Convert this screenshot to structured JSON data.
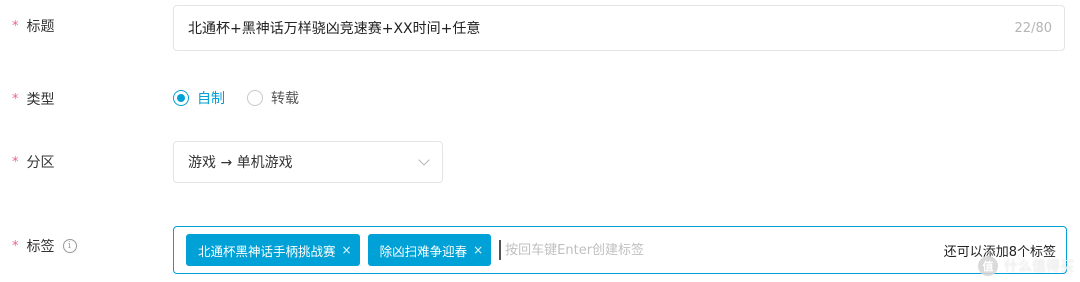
{
  "form": {
    "title": {
      "label": "标题",
      "value": "北通杯+黑神话万样骁凶竞速赛+XX时间+任意",
      "count": "22/80"
    },
    "type": {
      "label": "类型",
      "options": [
        {
          "label": "自制",
          "selected": true
        },
        {
          "label": "转载",
          "selected": false
        }
      ]
    },
    "zone": {
      "label": "分区",
      "value": "游戏 → 单机游戏"
    },
    "tags": {
      "label": "标签",
      "items": [
        "北通杯黑神话手柄挑战赛",
        "除凶扫难争迎春"
      ],
      "remove_glyph": "×",
      "placeholder": "按回车键Enter创建标签",
      "hint": "还可以添加8个标签"
    },
    "required_mark": "*",
    "info_glyph": "i"
  },
  "watermark": {
    "badge": "值",
    "text": "什么值得买"
  },
  "colors": {
    "accent": "#00a1d6",
    "required": "#f25d8e",
    "border": "#e2e5e7"
  }
}
